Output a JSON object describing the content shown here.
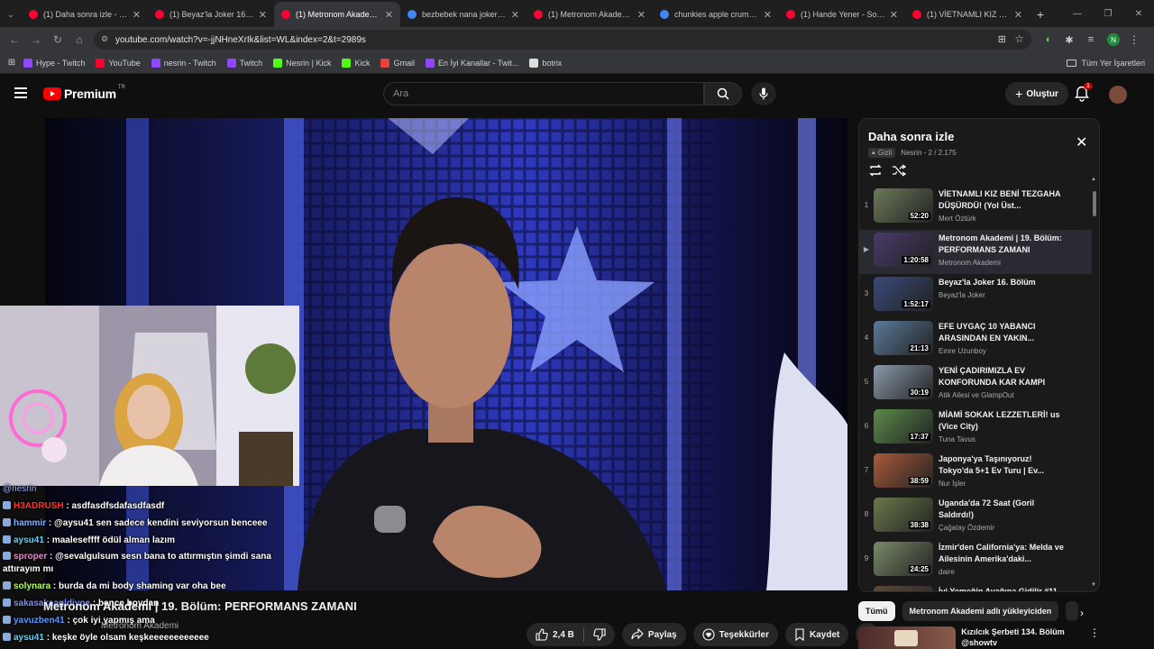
{
  "browser": {
    "tabs": [
      {
        "title": "(1) Daha sonra izle - YouTube",
        "color": "#ff0033",
        "active": false
      },
      {
        "title": "(1) Beyaz'la Joker 16. Bölüm",
        "color": "#ff0033",
        "active": false
      },
      {
        "title": "(1) Metronom Akademi | 19.",
        "color": "#ff0033",
        "active": true
      },
      {
        "title": "bezbebek nana joker - Google",
        "color": "#4285f4",
        "active": false
      },
      {
        "title": "(1) Metronom Akademi | 19.",
        "color": "#ff0033",
        "active": false
      },
      {
        "title": "chunkies apple crumble - Google",
        "color": "#4285f4",
        "active": false
      },
      {
        "title": "(1) Hande Yener - Sopa (Official",
        "color": "#ff0033",
        "active": false
      },
      {
        "title": "(1) VİETNAMLI KIZ BENİ TEZGAHA",
        "color": "#ff0033",
        "active": false
      }
    ],
    "url": "youtube.com/watch?v=-jjNHneXrIk&list=WL&index=2&t=2989s",
    "profile_initial": "N",
    "bookmarks": [
      {
        "label": "Hype - Twitch",
        "color": "#9146ff"
      },
      {
        "label": "YouTube",
        "color": "#ff0033"
      },
      {
        "label": "nesrin - Twitch",
        "color": "#9146ff"
      },
      {
        "label": "Twitch",
        "color": "#9146ff"
      },
      {
        "label": "Nesrin | Kick",
        "color": "#53fc18"
      },
      {
        "label": "Kick",
        "color": "#53fc18"
      },
      {
        "label": "Gmail",
        "color": "#ea4335"
      },
      {
        "label": "En İyi Kanallar - Twit...",
        "color": "#9146ff"
      },
      {
        "label": "botrix",
        "color": "#dddddd"
      }
    ],
    "all_bookmarks": "Tüm Yer İşaretleri"
  },
  "youtube": {
    "brand": "Premium",
    "country": "TR",
    "search_placeholder": "Ara",
    "create_label": "Oluştur",
    "notifications": "1",
    "video_title": "Metronom Akademi | 19. Bölüm: PERFORMANS ZAMANI",
    "channel": "Metronom Akademi",
    "actions": {
      "likes": "2,4 B",
      "share": "Paylaş",
      "thanks": "Teşekkürler",
      "save": "Kaydet"
    },
    "chips": [
      "Tümü",
      "Metronom Akademi adlı yükleyiciden"
    ],
    "rec_title": "Kızılcık Şerbeti 134. Bölüm @showtv"
  },
  "playlist": {
    "title": "Daha sonra izle",
    "privacy": "Gizli",
    "owner_progress": "Nesrin - 2 / 2.175",
    "items": [
      {
        "idx": "1",
        "title": "VİETNAMLI KIZ BENİ TEZGAHA DÜŞÜRDÜ! (Yol Üst...",
        "channel": "Mert Öztürk",
        "duration": "52:20",
        "color": "#6b7a5a"
      },
      {
        "idx": "▶",
        "title": "Metronom Akademi | 19. Bölüm: PERFORMANS ZAMANI",
        "channel": "Metronom Akademi",
        "duration": "1:20:58",
        "color": "#4a3a6a"
      },
      {
        "idx": "3",
        "title": "Beyaz'la Joker 16. Bölüm",
        "channel": "Beyaz'la Joker",
        "duration": "1:52:17",
        "color": "#3a4a7a"
      },
      {
        "idx": "4",
        "title": "EFE UYGAÇ 10 YABANCI ARASINDAN EN YAKIN...",
        "channel": "Emre Uzunboy",
        "duration": "21:13",
        "color": "#5a7a9a"
      },
      {
        "idx": "5",
        "title": "YENİ ÇADIRIMIZLA EV KONFORUNDA KAR KAMPI",
        "channel": "Atik Ailesi ve GlampOut",
        "duration": "30:19",
        "color": "#8a9aaa"
      },
      {
        "idx": "6",
        "title": "MİAMİ SOKAK LEZZETLERİ! us (Vice City)",
        "channel": "Tuna Tavus",
        "duration": "17:37",
        "color": "#5a8a4a"
      },
      {
        "idx": "7",
        "title": "Japonya'ya Taşınıyoruz! Tokyo'da 5+1 Ev Turu | Ev...",
        "channel": "Nur İşler",
        "duration": "38:59",
        "color": "#aa5a3a"
      },
      {
        "idx": "8",
        "title": "Uganda'da 72 Saat (Goril Saldırdı!)",
        "channel": "Çağatay Özdemir",
        "duration": "38:38",
        "color": "#6a7a4a"
      },
      {
        "idx": "9",
        "title": "İzmir'den California'ya: Melda ve Ailesinin Amerika'daki...",
        "channel": "daire",
        "duration": "24:25",
        "color": "#7a8a6a"
      },
      {
        "idx": "10",
        "title": "İyi Yemeğin Ayağına Gidilir #11",
        "channel": "",
        "duration": "",
        "color": "#5a4a3a"
      }
    ]
  },
  "stream": {
    "mention": "@nesrin",
    "chat": [
      {
        "user": "H3ADRUSH",
        "ucolor": "#ff3030",
        "text": "asdfasdfsdafasdfasdf"
      },
      {
        "user": "hammir",
        "ucolor": "#7fb2ff",
        "text": "@aysu41 sen sadece kendini seviyorsun benceee"
      },
      {
        "user": "aysu41",
        "ucolor": "#5ad7ff",
        "text": "maaleseffff ödül alman lazım"
      },
      {
        "user": "sproper",
        "ucolor": "#ff7ad9",
        "text": "@sevalgulsum sesn bana to attırmıştın şimdi sana attırayım mı"
      },
      {
        "user": "solynara",
        "ucolor": "#b4ff5a",
        "text": "burda da mi body shaming var oha bee"
      },
      {
        "user": "sakasakaagldiyoe",
        "ucolor": "#7a8cff",
        "text": "bence boydan"
      },
      {
        "user": "yavuzben41",
        "ucolor": "#5a9aff",
        "text": "çok iyi yapmış ama"
      },
      {
        "user": "aysu41",
        "ucolor": "#5ad7ff",
        "text": "keşke öyle olsam keşkeeeeeeeeeeee"
      }
    ]
  }
}
